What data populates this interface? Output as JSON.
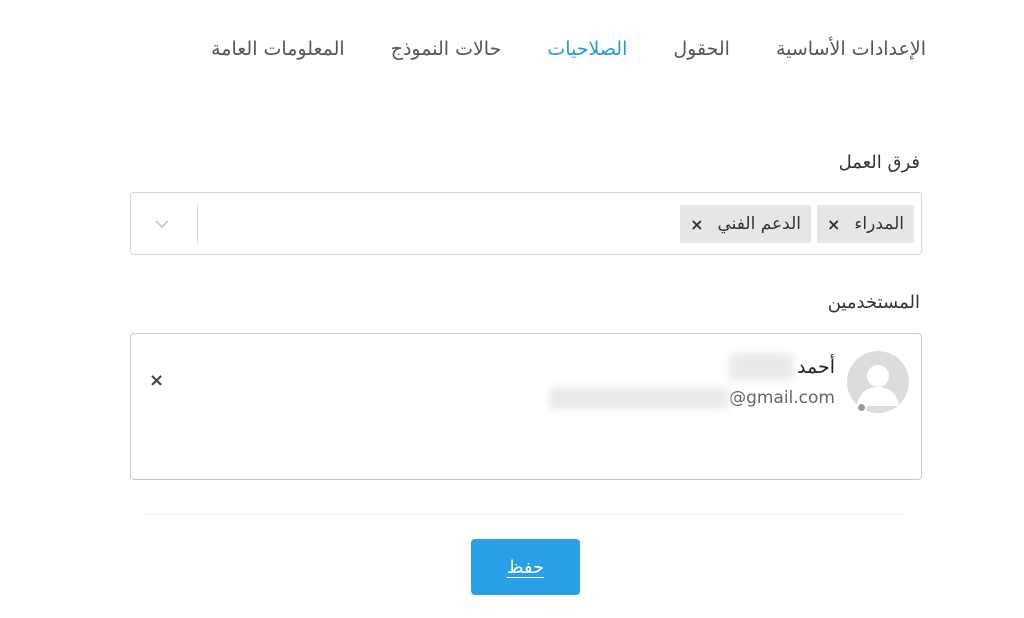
{
  "tabs": [
    {
      "label": "الإعدادات الأساسية",
      "active": false
    },
    {
      "label": "الحقول",
      "active": false
    },
    {
      "label": "الصلاحيات",
      "active": true
    },
    {
      "label": "حالات النموذج",
      "active": false
    },
    {
      "label": "المعلومات العامة",
      "active": false
    }
  ],
  "teams": {
    "label": "فرق العمل",
    "tags": [
      {
        "label": "المدراء",
        "remove": "×"
      },
      {
        "label": "الدعم الفني",
        "remove": "×"
      }
    ],
    "dropdown_icon": "chevron-down-icon"
  },
  "users": {
    "label": "المستخدمين",
    "list": [
      {
        "name": "أحمد",
        "email_suffix": "@gmail.com",
        "avatar_icon": "user-avatar-icon",
        "remove": "×"
      }
    ]
  },
  "save_button": {
    "label": "حفظ"
  },
  "colors": {
    "accent": "#1f9bde",
    "button": "#2a9fe8",
    "tag_bg": "#e6e6e6"
  }
}
